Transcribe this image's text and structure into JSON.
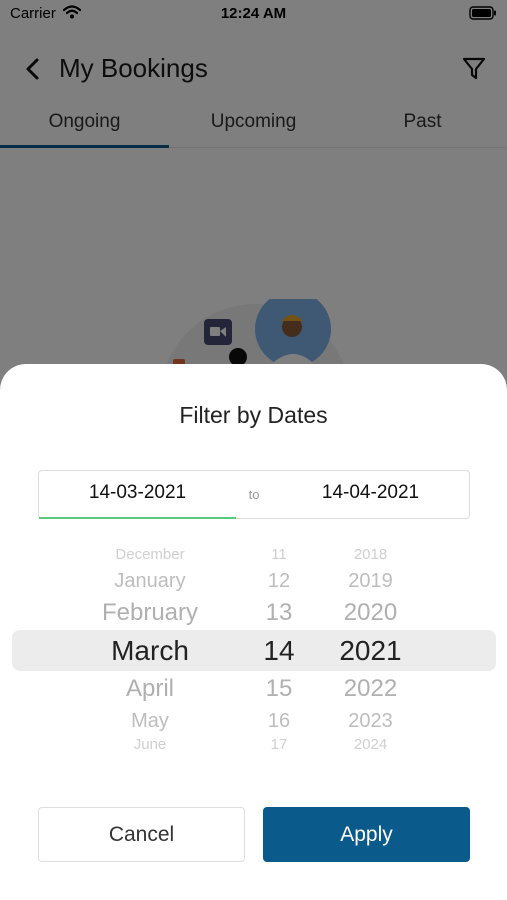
{
  "status_bar": {
    "carrier": "Carrier",
    "time": "12:24 AM"
  },
  "header": {
    "title": "My Bookings"
  },
  "tabs": [
    {
      "label": "Ongoing",
      "active": true
    },
    {
      "label": "Upcoming",
      "active": false
    },
    {
      "label": "Past",
      "active": false
    }
  ],
  "filter_sheet": {
    "title": "Filter by Dates",
    "from_date": "14-03-2021",
    "separator": "to",
    "to_date": "14-04-2021",
    "picker": {
      "months": [
        "December",
        "January",
        "February",
        "March",
        "April",
        "May",
        "June"
      ],
      "days": [
        "11",
        "12",
        "13",
        "14",
        "15",
        "16",
        "17"
      ],
      "years": [
        "2018",
        "2019",
        "2020",
        "2021",
        "2022",
        "2023",
        "2024"
      ],
      "selected": {
        "month": "March",
        "day": "14",
        "year": "2021"
      }
    },
    "cancel_label": "Cancel",
    "apply_label": "Apply"
  },
  "colors": {
    "accent": "#0a5b8c",
    "active_field_underline": "#59c97d",
    "overlay": "rgba(0,0,0,0.5)"
  },
  "icons": {
    "wifi": "wifi-icon",
    "battery": "battery-icon",
    "back": "chevron-left-icon",
    "filter": "filter-icon"
  }
}
